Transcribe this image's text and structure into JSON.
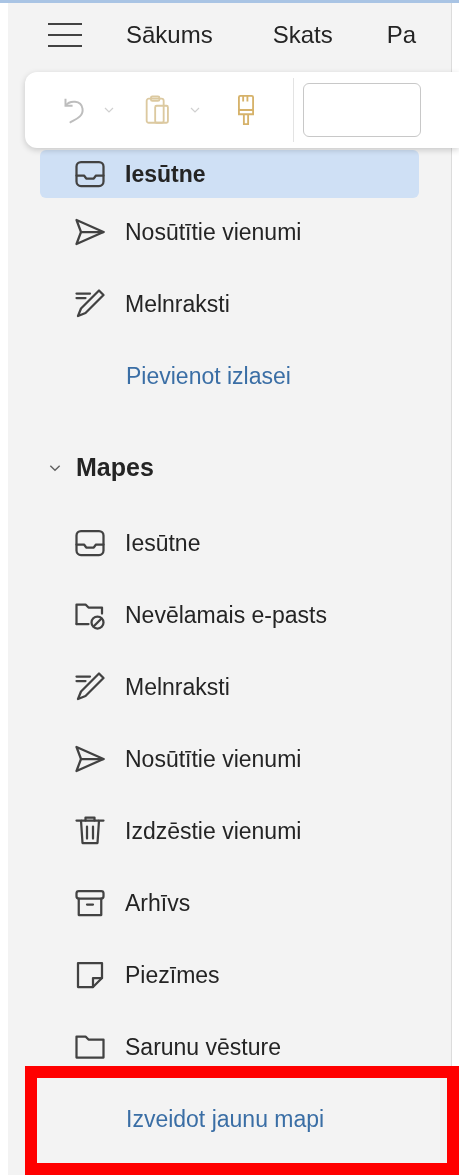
{
  "menu_bar": {
    "tabs": [
      {
        "label": "Sākums"
      },
      {
        "label": "Skats"
      },
      {
        "label": "Pa"
      }
    ]
  },
  "favorites": {
    "items": [
      {
        "kind": "inbox",
        "label": "Iesūtne",
        "selected": true
      },
      {
        "kind": "sent",
        "label": "Nosūtītie vienumi",
        "selected": false
      },
      {
        "kind": "drafts",
        "label": "Melnraksti",
        "selected": false
      },
      {
        "kind": "link",
        "label": "Pievienot izlasei"
      }
    ]
  },
  "folders": {
    "title": "Mapes",
    "expanded": true,
    "items": [
      {
        "kind": "inbox",
        "label": "Iesūtne",
        "selected": false
      },
      {
        "kind": "junk",
        "label": "Nevēlamais e-pasts",
        "selected": false
      },
      {
        "kind": "drafts",
        "label": "Melnraksti",
        "selected": false
      },
      {
        "kind": "sent",
        "label": "Nosūtītie vienumi",
        "selected": false
      },
      {
        "kind": "deleted",
        "label": "Izdzēstie vienumi",
        "selected": false
      },
      {
        "kind": "archive",
        "label": "Arhīvs",
        "selected": false
      },
      {
        "kind": "notes",
        "label": "Piezīmes",
        "selected": false
      },
      {
        "kind": "folder",
        "label": "Sarunu vēsture",
        "selected": false
      },
      {
        "kind": "link",
        "label": "Izveidot jaunu mapi"
      }
    ]
  }
}
